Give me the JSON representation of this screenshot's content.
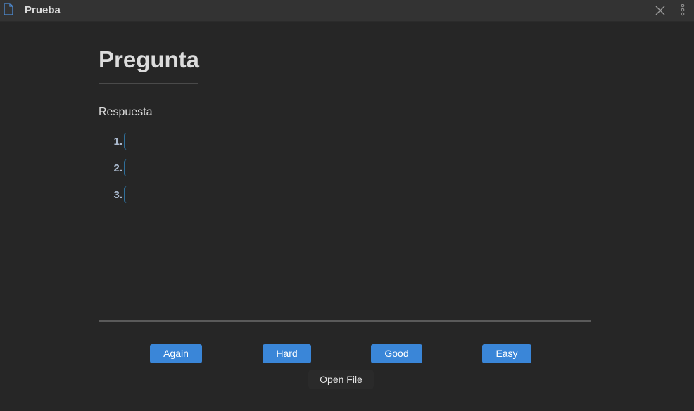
{
  "tab": {
    "title": "Prueba",
    "icon": "file-icon",
    "close_icon": "close-icon",
    "more_icon": "more-options-icon"
  },
  "note": {
    "heading": "Pregunta",
    "answer_label": "Respuesta",
    "list": [
      "1.",
      "2.",
      "3."
    ]
  },
  "review": {
    "buttons": {
      "again": "Again",
      "hard": "Hard",
      "good": "Good",
      "easy": "Easy"
    },
    "open_file": "Open File"
  },
  "colors": {
    "background": "#262626",
    "titlebar": "#333333",
    "accent": "#3a86d8",
    "list_number": "#a9b8cc",
    "caret": "#2f6f9a"
  }
}
